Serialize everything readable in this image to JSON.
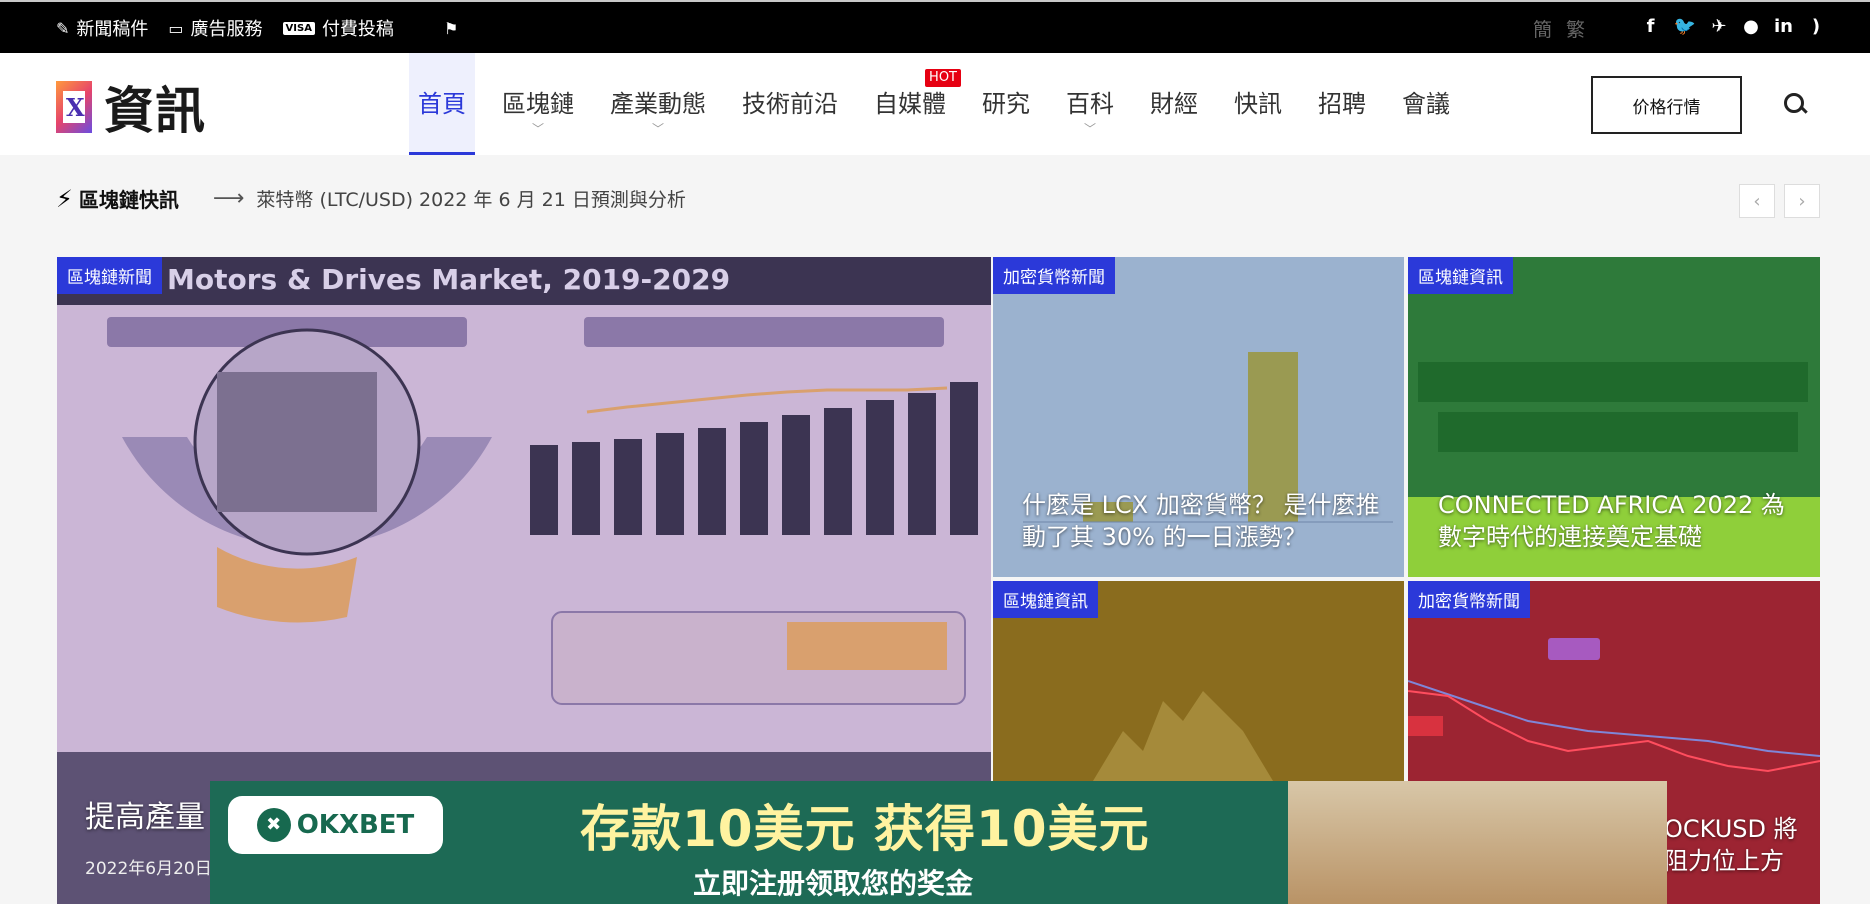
{
  "topbar": {
    "links": [
      {
        "icon": "edit-icon",
        "label": "新聞稿件"
      },
      {
        "icon": "monitor-icon",
        "label": "廣告服務"
      },
      {
        "icon": "visa-icon",
        "label": "付費投稿"
      }
    ],
    "translate_icon": "translate-icon",
    "lang": "簡 繁",
    "social": [
      "f",
      "t",
      "✈",
      "r",
      "in",
      "rss"
    ]
  },
  "header": {
    "logo_text": "資訊",
    "nav": [
      {
        "label": "首頁",
        "active": true,
        "dropdown": false
      },
      {
        "label": "區塊鏈",
        "dropdown": true
      },
      {
        "label": "產業動態",
        "dropdown": true
      },
      {
        "label": "技術前沿",
        "dropdown": false
      },
      {
        "label": "自媒體",
        "dropdown": false,
        "badge": "HOT"
      },
      {
        "label": "研究",
        "dropdown": false
      },
      {
        "label": "百科",
        "dropdown": true
      },
      {
        "label": "財經",
        "dropdown": false
      },
      {
        "label": "快訊",
        "dropdown": false
      },
      {
        "label": "招聘",
        "dropdown": false
      },
      {
        "label": "會議",
        "dropdown": false
      }
    ],
    "price_button": "价格行情"
  },
  "ticker": {
    "label": "區塊鏈快訊",
    "text": "萊特幣 (LTC/USD) 2022 年 6 月 21 日預測與分析",
    "prev": "‹",
    "next": "›"
  },
  "tiles": [
    {
      "category": "區塊鏈新聞",
      "title": "提高產量",
      "date": "2022年6月20日",
      "image_text": "Motors & Drives Market, 2019-2029"
    },
    {
      "category": "加密貨幣新聞",
      "title": "什麼是 LCX 加密貨幣？ 是什麼推動了其 30% 的一日漲勢？"
    },
    {
      "category": "區塊鏈資訊",
      "title": "CONNECTED AFRICA 2022 為數字時代的連接奠定基礎"
    },
    {
      "category": "區塊鏈資訊",
      "title": ""
    },
    {
      "category": "加密貨幣新聞",
      "title": "OCKUSD 將 阻力位上方"
    }
  ],
  "ad": {
    "brand": "OKXBET",
    "headline": "存款10美元 获得10美元",
    "subline": "立即注册领取您的奖金"
  }
}
